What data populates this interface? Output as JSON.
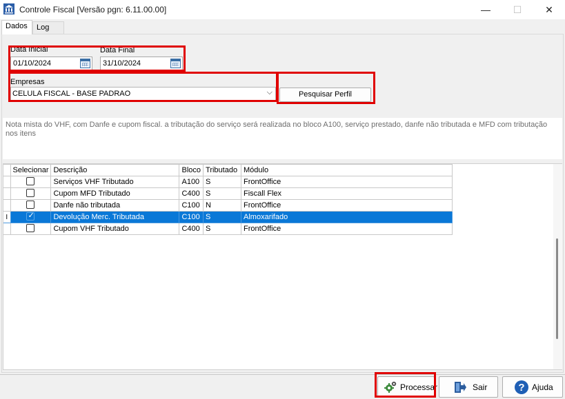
{
  "window": {
    "title": "Controle Fiscal [Versão pgn: 6.11.00.00]",
    "minimize": "—",
    "maximize": "☐",
    "close": "✕"
  },
  "tabs": [
    {
      "label": "Dados",
      "active": true
    },
    {
      "label": "Log",
      "active": false
    }
  ],
  "form": {
    "data_inicial_label": "Data Inicial",
    "data_inicial_value": "01/10/2024",
    "data_final_label": "Data Final",
    "data_final_value": "31/10/2024",
    "empresas_label": "Empresas",
    "empresas_value": "CELULA FISCAL - BASE PADRAO",
    "pesquisar_label": "Pesquisar Perfil"
  },
  "description": "Nota mista do VHF, com Danfe e cupom fiscal. a tributação do serviço será realizada no bloco A100, serviço prestado, danfe não tributada e MFD com tributação nos itens",
  "grid": {
    "columns": [
      "Selecionar",
      "Descrição",
      "Bloco",
      "Tributado",
      "Módulo"
    ],
    "rows": [
      {
        "selecionar": false,
        "descricao": "Serviços VHF Tributado",
        "bloco": "A100",
        "tributado": "S",
        "modulo": "FrontOffice",
        "selected": false
      },
      {
        "selecionar": false,
        "descricao": "Cupom MFD Tributado",
        "bloco": "C400",
        "tributado": "S",
        "modulo": "Fiscall Flex",
        "selected": false
      },
      {
        "selecionar": false,
        "descricao": "Danfe não tributada",
        "bloco": "C100",
        "tributado": "N",
        "modulo": "FrontOffice",
        "selected": false
      },
      {
        "selecionar": true,
        "descricao": "Devolução Merc. Tributada",
        "bloco": "C100",
        "tributado": "S",
        "modulo": "Almoxarifado",
        "selected": true
      },
      {
        "selecionar": false,
        "descricao": "Cupom VHF Tributado",
        "bloco": "C400",
        "tributado": "S",
        "modulo": "FrontOffice",
        "selected": false
      }
    ],
    "current_row_indicator": "I"
  },
  "buttons": {
    "processar": "Processar",
    "sair": "Sair",
    "ajuda": "Ajuda"
  },
  "colors": {
    "selection": "#0a78d7",
    "highlight_box": "#e00000"
  }
}
